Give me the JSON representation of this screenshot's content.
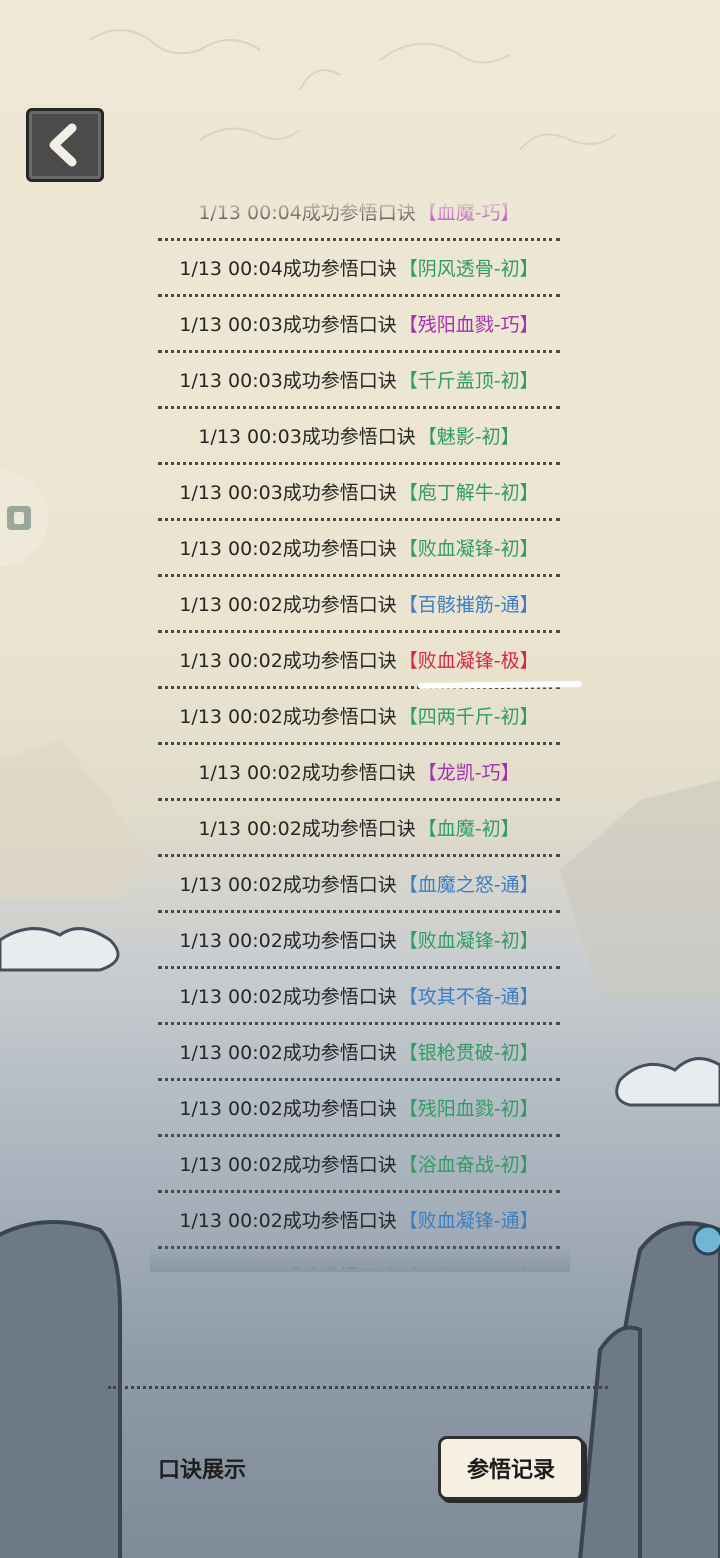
{
  "back_icon": "chevron-left-icon",
  "side_tab_icon": "tab-icon",
  "log": {
    "partial_top": {
      "time": "1/13 00:04成功参悟口诀",
      "skill": "【血魔-巧】",
      "color": "#a52fb1"
    },
    "rows": [
      {
        "time": "1/13 00:04成功参悟口诀",
        "skill": "【阴风透骨-初】",
        "color": "#2f9d63"
      },
      {
        "time": "1/13 00:03成功参悟口诀",
        "skill": "【残阳血戮-巧】",
        "color": "#a52fb1"
      },
      {
        "time": "1/13 00:03成功参悟口诀",
        "skill": "【千斤盖顶-初】",
        "color": "#2f9d63"
      },
      {
        "time": "1/13 00:03成功参悟口诀",
        "skill": "【魅影-初】",
        "color": "#2f9d63"
      },
      {
        "time": "1/13 00:03成功参悟口诀",
        "skill": "【庖丁解牛-初】",
        "color": "#2f9d63"
      },
      {
        "time": "1/13 00:02成功参悟口诀",
        "skill": "【败血凝锋-初】",
        "color": "#2f9d63"
      },
      {
        "time": "1/13 00:02成功参悟口诀",
        "skill": "【百骸摧筋-通】",
        "color": "#3c7ec4"
      },
      {
        "time": "1/13 00:02成功参悟口诀",
        "skill": "【败血凝锋-极】",
        "color": "#d4283d"
      },
      {
        "time": "1/13 00:02成功参悟口诀",
        "skill": "【四两千斤-初】",
        "color": "#2f9d63"
      },
      {
        "time": "1/13 00:02成功参悟口诀",
        "skill": "【龙凯-巧】",
        "color": "#a52fb1"
      },
      {
        "time": "1/13 00:02成功参悟口诀",
        "skill": "【血魔-初】",
        "color": "#2f9d63"
      },
      {
        "time": "1/13 00:02成功参悟口诀",
        "skill": "【血魔之怒-通】",
        "color": "#3c7ec4"
      },
      {
        "time": "1/13 00:02成功参悟口诀",
        "skill": "【败血凝锋-初】",
        "color": "#2f9d63"
      },
      {
        "time": "1/13 00:02成功参悟口诀",
        "skill": "【攻其不备-通】",
        "color": "#3c7ec4"
      },
      {
        "time": "1/13 00:02成功参悟口诀",
        "skill": "【银枪贯破-初】",
        "color": "#2f9d63"
      },
      {
        "time": "1/13 00:02成功参悟口诀",
        "skill": "【残阳血戮-初】",
        "color": "#2f9d63"
      },
      {
        "time": "1/13 00:02成功参悟口诀",
        "skill": "【浴血奋战-初】",
        "color": "#2f9d63"
      },
      {
        "time": "1/13 00:02成功参悟口诀",
        "skill": "【败血凝锋-通】",
        "color": "#3c7ec4"
      }
    ],
    "partial_bottom": {
      "time": "1/13 00:02成功参悟口诀",
      "skill": "【残阳血戮-初】",
      "color": "#2f9d63"
    }
  },
  "footer": {
    "label": "口诀展示",
    "record_button": "参悟记录"
  }
}
